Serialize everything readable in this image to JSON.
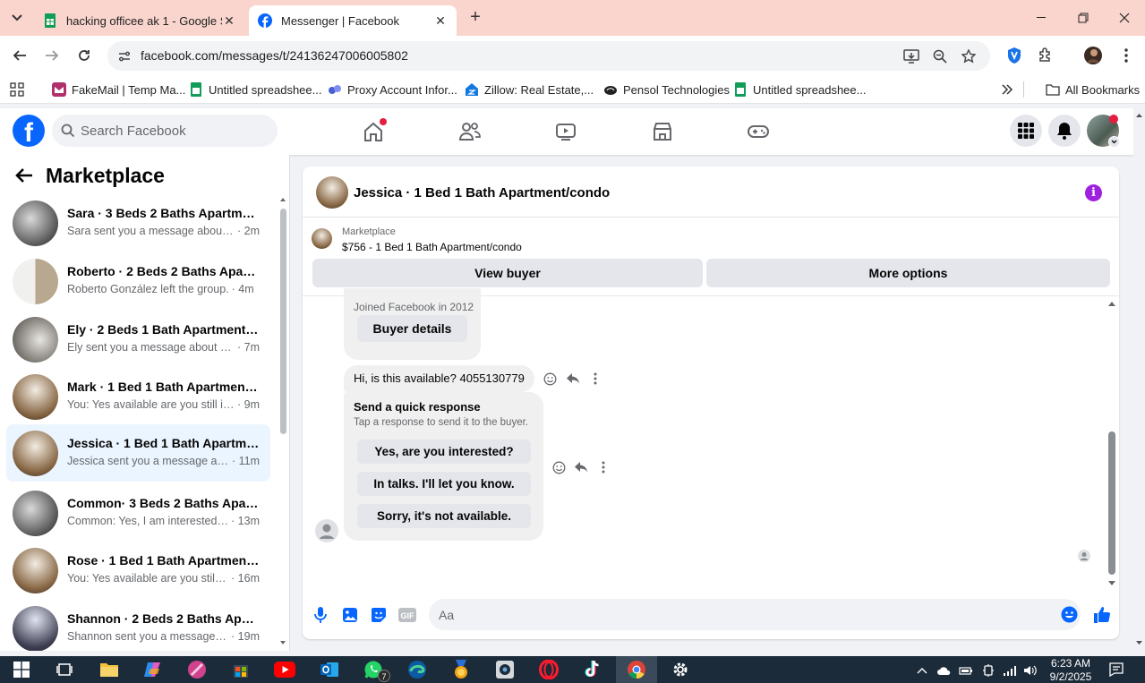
{
  "browser": {
    "tabs": [
      {
        "title": "hacking officee ak 1 - Google Sh",
        "icon": "google-sheets-icon"
      },
      {
        "title": "Messenger | Facebook",
        "icon": "facebook-icon"
      }
    ],
    "url": "facebook.com/messages/t/24136247006005802",
    "bookmarks": [
      {
        "label": "FakeMail | Temp Ma..."
      },
      {
        "label": "Untitled spreadshee..."
      },
      {
        "label": "Proxy Account Infor..."
      },
      {
        "label": "Zillow: Real Estate,..."
      },
      {
        "label": "Pensol Technologies"
      },
      {
        "label": "Untitled spreadshee..."
      }
    ],
    "all_bookmarks": "All Bookmarks"
  },
  "fb": {
    "logo": "f",
    "search_placeholder": "Search Facebook"
  },
  "sidebar": {
    "title": "Marketplace",
    "conversations": [
      {
        "name": "Sara · 3 Beds 2 Baths Apartment...",
        "preview": "Sara sent you a message about yo...",
        "time": "· 2m"
      },
      {
        "name": "Roberto · 2 Beds 2 Baths Apart...",
        "preview": "Roberto González left the group.",
        "time": "· 4m"
      },
      {
        "name": "Ely · 2 Beds 1 Bath Apartment/c...",
        "preview": "Ely sent you a message about you...",
        "time": "· 7m"
      },
      {
        "name": "Mark · 1 Bed 1 Bath Apartment/...",
        "preview": "You: Yes available are you still inter...",
        "time": "· 9m"
      },
      {
        "name": "Jessica · 1 Bed 1 Bath Apartment...",
        "preview": "Jessica sent you a message abou...",
        "time": "· 11m"
      },
      {
        "name": "Common· 3 Beds 2 Baths Apart...",
        "preview": "Common: Yes, I am interested. M...",
        "time": "· 13m"
      },
      {
        "name": "Rose · 1 Bed 1 Bath Apartment/c...",
        "preview": "You: Yes available are you still int...",
        "time": "· 16m"
      },
      {
        "name": "Shannon · 2 Beds 2 Baths Apart...",
        "preview": "Shannon sent you a message ab...",
        "time": "· 19m"
      }
    ]
  },
  "chat": {
    "title": "Jessica · 1 Bed 1 Bath Apartment/condo",
    "listing_source": "Marketplace",
    "listing_price": "$756 - 1 Bed 1 Bath Apartment/condo",
    "view_buyer": "View buyer",
    "more_options": "More options",
    "joined": "Joined Facebook in 2012",
    "buyer_details": "Buyer details",
    "message": "Hi, is this available? 4055130779",
    "quick_title": "Send a quick response",
    "quick_sub": "Tap a response to send it to the buyer.",
    "quick_replies": [
      "Yes, are you interested?",
      "In talks. I'll let you know.",
      "Sorry, it's not available."
    ],
    "composer_placeholder": "Aa"
  },
  "taskbar": {
    "time": "6:23 AM",
    "date": "9/2/2025",
    "whatsapp_badge": "7"
  },
  "colors": {
    "fb_blue": "#0866ff",
    "selected_conv": "#ebf5ff",
    "info_purple": "#a020e0",
    "tabstrip": "#f9d5cd"
  }
}
